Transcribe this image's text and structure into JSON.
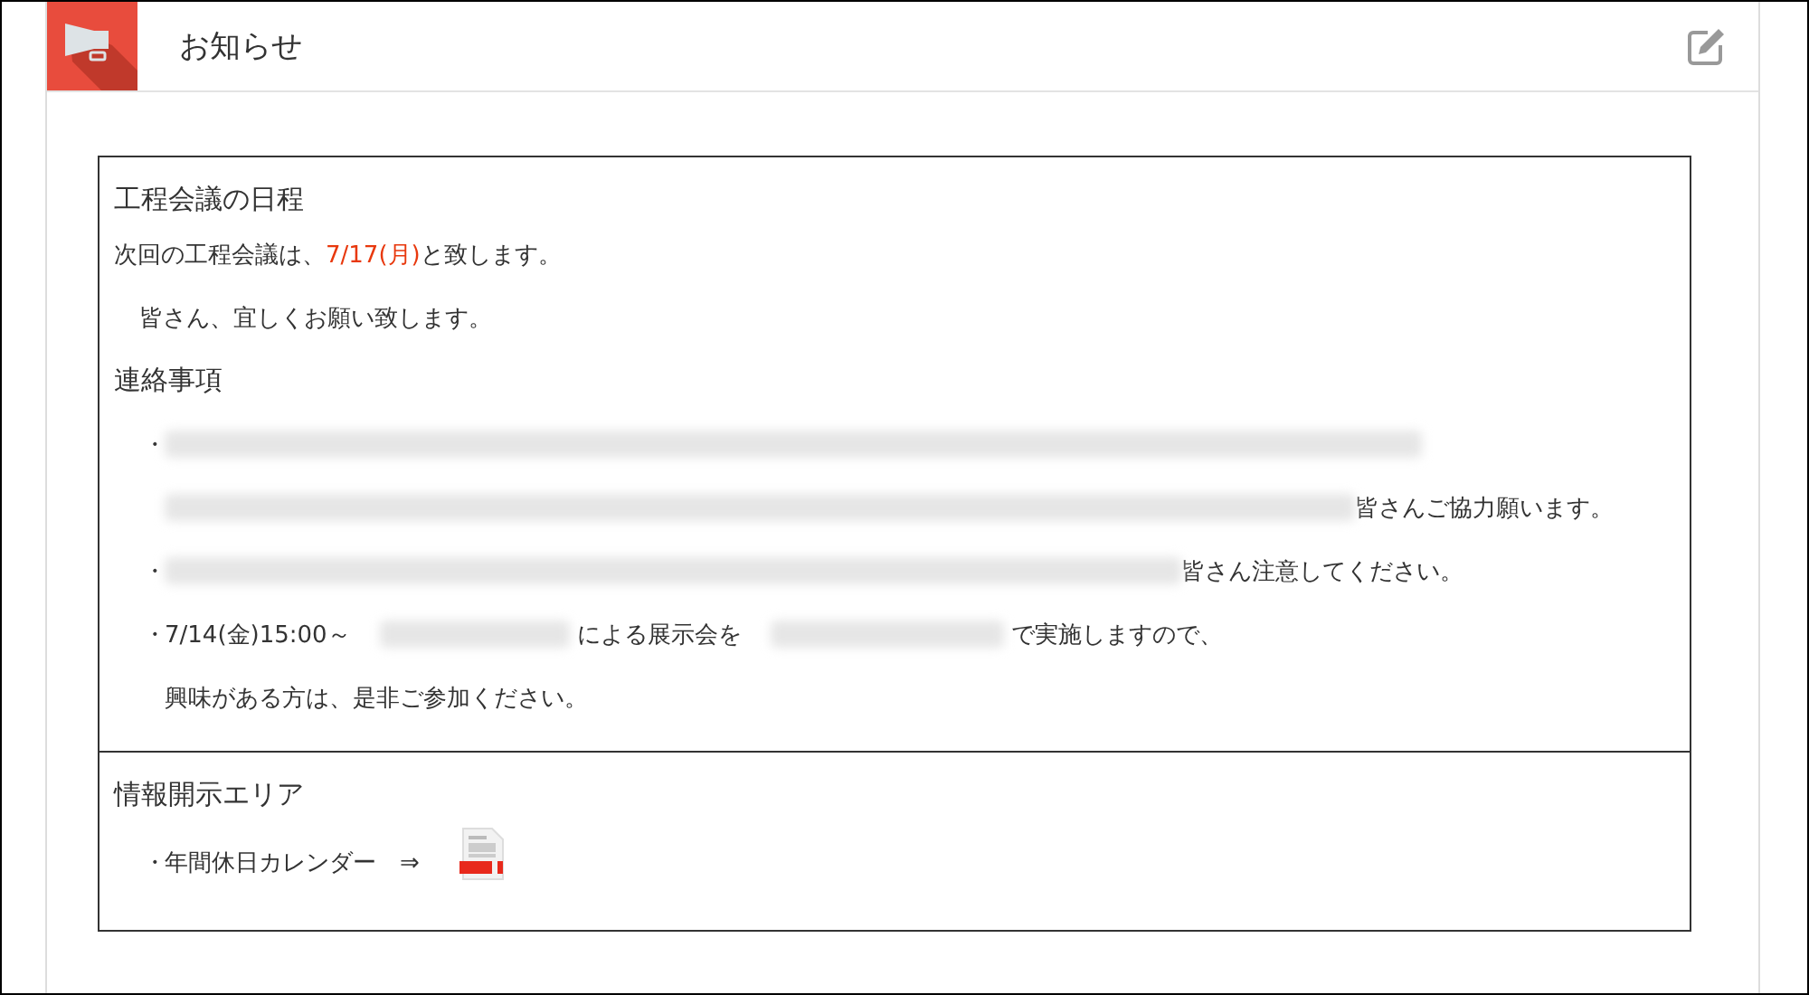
{
  "header": {
    "title": "お知らせ"
  },
  "sections": [
    {
      "heading": "工程会議の日程",
      "lines": [
        {
          "kind": "plain",
          "segments": [
            {
              "kind": "text",
              "text": "次回の工程会議は、"
            },
            {
              "kind": "highlight",
              "text": "7/17(月)"
            },
            {
              "kind": "text",
              "text": "と致します。"
            }
          ]
        },
        {
          "kind": "indented",
          "segments": [
            {
              "kind": "text",
              "text": "皆さん、宜しくお願い致します。"
            }
          ]
        },
        {
          "kind": "subheading",
          "segments": [
            {
              "kind": "text",
              "text": "連絡事項"
            }
          ]
        },
        {
          "kind": "bullet",
          "marker": "・",
          "segments": [
            {
              "kind": "redacted"
            }
          ]
        },
        {
          "kind": "continuation",
          "segments": [
            {
              "kind": "redacted"
            },
            {
              "kind": "text",
              "text": "皆さんご協力願います。"
            }
          ]
        },
        {
          "kind": "bullet",
          "marker": "・",
          "segments": [
            {
              "kind": "redacted"
            },
            {
              "kind": "text",
              "text": "皆さん注意してください。"
            }
          ]
        },
        {
          "kind": "bullet",
          "marker": "・",
          "segments": [
            {
              "kind": "text",
              "text": "7/14(金)15:00～"
            },
            {
              "kind": "redacted"
            },
            {
              "kind": "text",
              "text": "による展示会を"
            },
            {
              "kind": "redacted"
            },
            {
              "kind": "text",
              "text": "で実施しますので、"
            }
          ]
        },
        {
          "kind": "continuation",
          "segments": [
            {
              "kind": "text",
              "text": "興味がある方は、是非ご参加ください。"
            }
          ]
        }
      ]
    },
    {
      "heading": "情報開示エリア",
      "lines": [
        {
          "kind": "bullet",
          "marker": "・",
          "segments": [
            {
              "kind": "text",
              "text": "年間休日カレンダー　⇒"
            },
            {
              "kind": "pdf-link"
            }
          ]
        }
      ]
    }
  ]
}
